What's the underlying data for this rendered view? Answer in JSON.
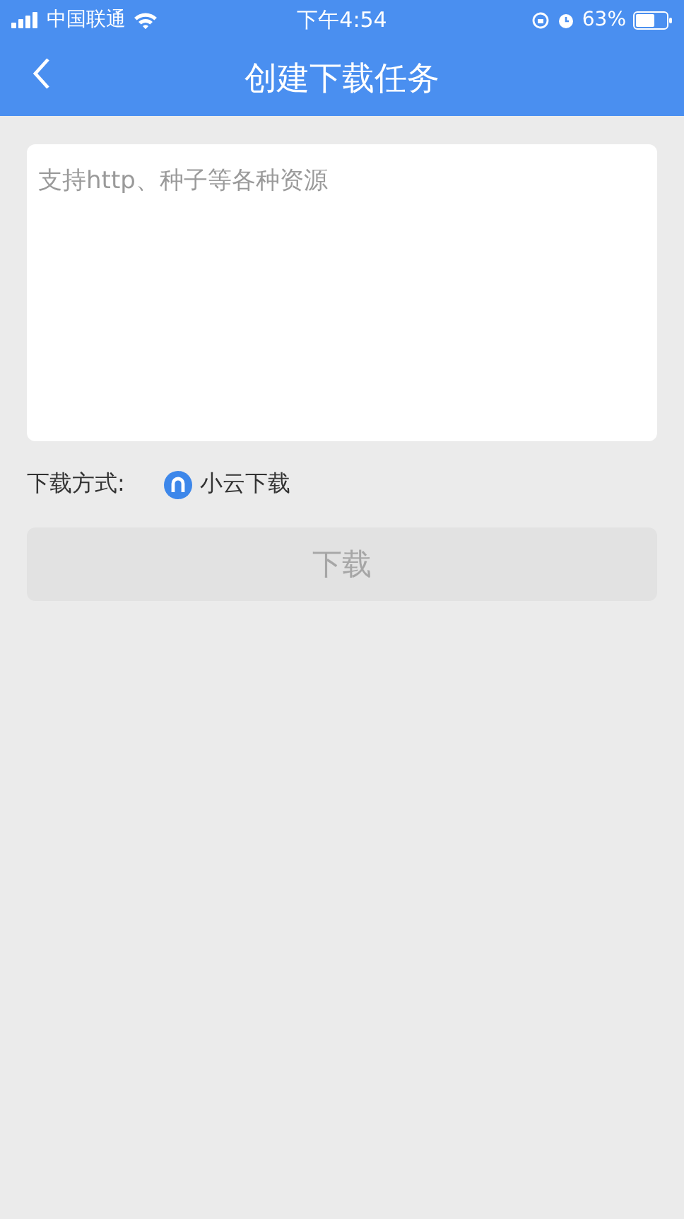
{
  "status_bar": {
    "carrier": "中国联通",
    "time": "下午4:54",
    "battery": "63%"
  },
  "nav_bar": {
    "title": "创建下载任务"
  },
  "source_field": {
    "placeholder": "支持http、种子等各种资源"
  },
  "download_method": {
    "label": "下载方式:",
    "option": "小云下载"
  },
  "download_button": {
    "label": "下载",
    "disabled": true
  }
}
